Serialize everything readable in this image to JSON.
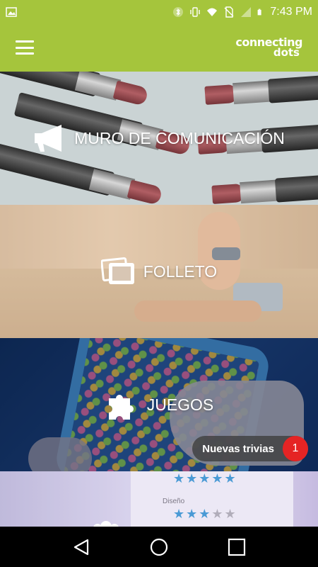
{
  "status_bar": {
    "time": "7:43 PM",
    "icons": [
      "image-icon",
      "bluetooth-icon",
      "vibrate-icon",
      "wifi-icon",
      "no-sim-icon",
      "signal-icon",
      "battery-icon"
    ]
  },
  "app_bar": {
    "brand_line1": "connecting",
    "brand_line2": "dots",
    "accent_color": "#a5c53c"
  },
  "tiles": [
    {
      "label": "MURO DE COMUNICACIÓN",
      "icon": "megaphone-icon"
    },
    {
      "label": "FOLLETO",
      "icon": "photos-icon"
    },
    {
      "label": "JUEGOS",
      "icon": "puzzle-icon"
    },
    {
      "label": "",
      "icon": "group-icon",
      "card_text": "Diseño"
    }
  ],
  "notification": {
    "text": "Nuevas trivias",
    "count": "1",
    "badge_color": "#e52424"
  },
  "nav_bar": {
    "buttons": [
      "back-icon",
      "home-icon",
      "recents-icon"
    ]
  }
}
